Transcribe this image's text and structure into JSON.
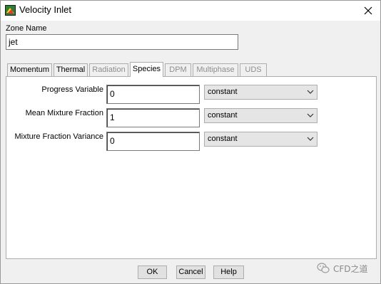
{
  "window": {
    "title": "Velocity Inlet"
  },
  "zone": {
    "label": "Zone Name",
    "value": "jet"
  },
  "tabs": [
    {
      "label": "Momentum",
      "enabled": true,
      "active": false
    },
    {
      "label": "Thermal",
      "enabled": true,
      "active": false
    },
    {
      "label": "Radiation",
      "enabled": false,
      "active": false
    },
    {
      "label": "Species",
      "enabled": true,
      "active": true
    },
    {
      "label": "DPM",
      "enabled": false,
      "active": false
    },
    {
      "label": "Multiphase",
      "enabled": false,
      "active": false
    },
    {
      "label": "UDS",
      "enabled": false,
      "active": false
    }
  ],
  "species": {
    "fields": [
      {
        "label": "Progress Variable",
        "value": "0",
        "method": "constant"
      },
      {
        "label": "Mean Mixture Fraction",
        "value": "1",
        "method": "constant"
      },
      {
        "label": "Mixture Fraction Variance",
        "value": "0",
        "method": "constant"
      }
    ]
  },
  "buttons": {
    "ok": "OK",
    "cancel": "Cancel",
    "help": "Help"
  },
  "watermark": {
    "text": "CFD之道"
  },
  "icons": {
    "app": "fluent-app-icon",
    "close": "close-icon",
    "dropdown": "chevron-down-icon",
    "watermark": "wechat-icon"
  }
}
